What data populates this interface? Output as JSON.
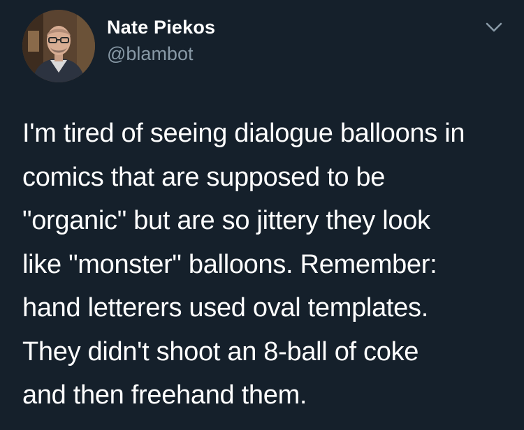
{
  "tweet": {
    "author": {
      "display_name": "Nate Piekos",
      "handle": "@blambot",
      "avatar_icon": "profile-photo-avatar"
    },
    "menu_icon": "chevron-down-icon",
    "text": "I'm tired of seeing dialogue balloons in\ncomics that are supposed to be\n\"organic\" but are so jittery they look\nlike \"monster\" balloons. Remember:\nhand letterers used oval templates.\nThey didn't shoot an 8-ball of coke\nand then freehand them."
  },
  "colors": {
    "background": "#15202b",
    "primary_text": "#ffffff",
    "secondary_text": "#8899a6"
  }
}
